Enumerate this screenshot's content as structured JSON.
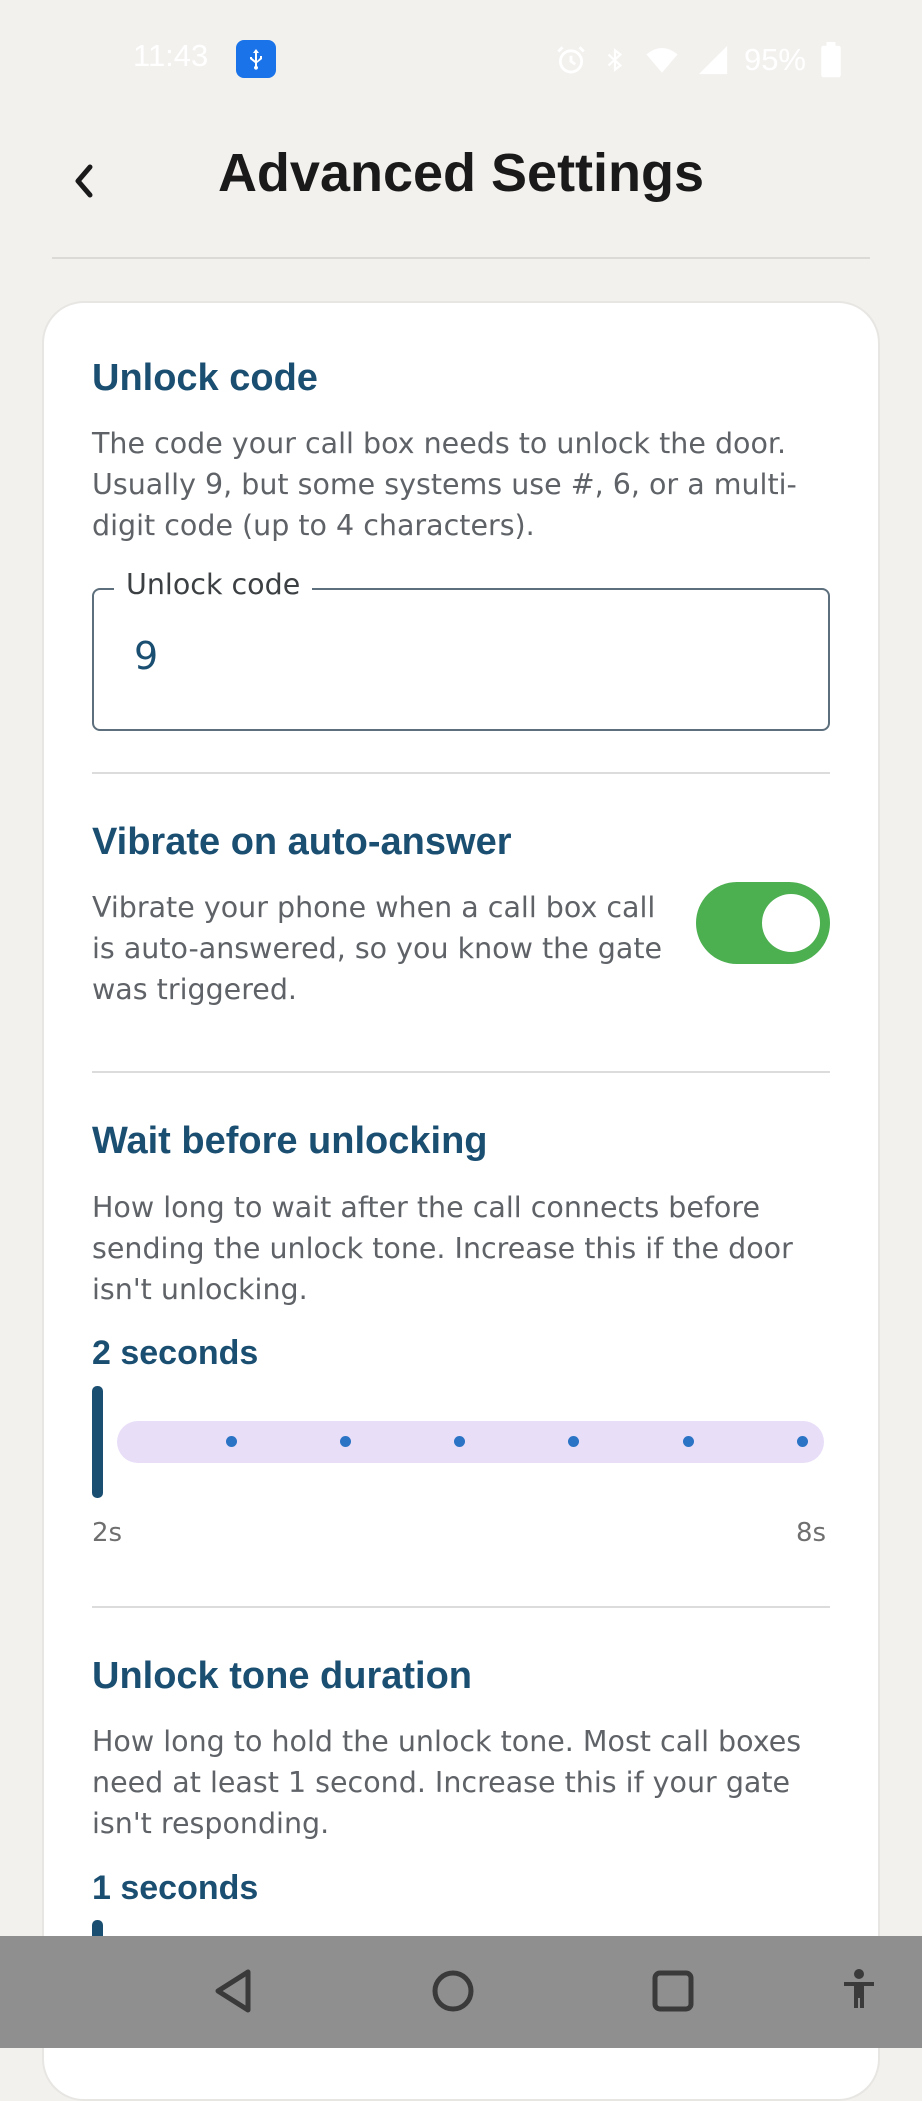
{
  "status_bar": {
    "time": "11:43",
    "battery": "95%",
    "icons": [
      "usb-icon",
      "alarm-icon",
      "bluetooth-icon",
      "wifi-icon",
      "cell-signal-icon",
      "battery-icon"
    ]
  },
  "header": {
    "back_icon": "chevron-left-icon",
    "title": "Advanced Settings"
  },
  "unlock_code": {
    "title": "Unlock code",
    "description": "The code your call box needs to unlock the door. Usually 9, but some systems use #, 6, or a multi-digit code (up to 4 characters).",
    "field_label": "Unlock code",
    "field_value": "9"
  },
  "vibrate": {
    "title": "Vibrate on auto-answer",
    "description": "Vibrate your phone when a call box call is auto-answered, so you know the gate was triggered.",
    "enabled": true
  },
  "wait_before_unlocking": {
    "title": "Wait before unlocking",
    "description": "How long to wait after the call connects before sending the unlock tone. Increase this if the door isn't unlocking.",
    "value_label": "2 seconds",
    "value": 2,
    "min": 2,
    "max": 8,
    "min_label": "2s",
    "max_label": "8s"
  },
  "unlock_tone_duration": {
    "title": "Unlock tone duration",
    "description": "How long to hold the unlock tone. Most call boxes need at least 1 second. Increase this if your gate isn't responding.",
    "value_label": "1 seconds"
  },
  "nav_bar": {
    "items": [
      "back-nav-icon",
      "home-nav-icon",
      "recents-nav-icon",
      "accessibility-icon"
    ]
  },
  "colors": {
    "accent": "#1b4f72",
    "toggle_on": "#4caf50",
    "slider_track": "#e8def8",
    "tick": "#2a73c5"
  }
}
